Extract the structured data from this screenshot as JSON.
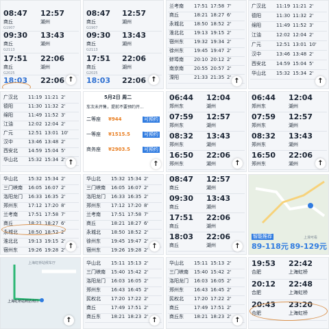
{
  "tiles": {
    "t1": {
      "rows": [
        {
          "dep": "08:47",
          "arr": "12:57",
          "from": "商丘",
          "to": "湖州",
          "train": "G1907"
        },
        {
          "dep": "09:30",
          "arr": "13:43",
          "from": "商丘",
          "to": "湖州",
          "train": "G2113"
        },
        {
          "dep": "17:51",
          "arr": "22:06",
          "from": "商丘",
          "to": "湖州",
          "train": "G2025"
        },
        {
          "dep": "18:03",
          "arr": "22:06",
          "from": "商丘",
          "to": "湖州",
          "train": ""
        }
      ]
    },
    "t2": {
      "rows": [
        {
          "dep": "08:47",
          "arr": "12:57",
          "from": "商丘",
          "to": "湖州",
          "train": "G1907"
        },
        {
          "dep": "09:30",
          "arr": "13:43",
          "from": "商丘",
          "to": "湖州",
          "train": "G2113"
        },
        {
          "dep": "17:51",
          "arr": "22:06",
          "from": "商丘",
          "to": "湖州",
          "train": "G2025"
        },
        {
          "dep": "18:03",
          "arr": "22:06",
          "from": "商丘",
          "to": "湖州",
          "train": ""
        }
      ]
    },
    "t3": {
      "rows": [
        {
          "station": "兰考南",
          "arr": "17:51",
          "dep": "17:58",
          "stop": "7'"
        },
        {
          "station": "商丘",
          "arr": "18:21",
          "dep": "18:27",
          "stop": "6'"
        },
        {
          "station": "永城北",
          "arr": "18:50",
          "dep": "18:52",
          "stop": "2'"
        },
        {
          "station": "淮北北",
          "arr": "19:13",
          "dep": "19:15",
          "stop": "2'"
        },
        {
          "station": "宿州东",
          "arr": "19:32",
          "dep": "19:34",
          "stop": "2'"
        },
        {
          "station": "徐州东",
          "arr": "19:45",
          "dep": "19:47",
          "stop": "2'"
        },
        {
          "station": "蚌埠南",
          "arr": "20:10",
          "dep": "20:12",
          "stop": "2'"
        },
        {
          "station": "南京南",
          "arr": "20:55",
          "dep": "20:57",
          "stop": "2'"
        },
        {
          "station": "溧阳",
          "arr": "21:33",
          "dep": "21:35",
          "stop": "2'"
        }
      ]
    },
    "t4": {
      "rows": [
        {
          "station": "广汉北",
          "arr": "11:19",
          "dep": "11:21",
          "stop": "2'"
        },
        {
          "station": "德阳",
          "arr": "11:30",
          "dep": "11:32",
          "stop": "2'"
        },
        {
          "station": "绵阳",
          "arr": "11:49",
          "dep": "11:52",
          "stop": "3'"
        },
        {
          "station": "江油",
          "arr": "12:02",
          "dep": "12:04",
          "stop": "2'"
        },
        {
          "station": "广元",
          "arr": "12:51",
          "dep": "13:01",
          "stop": "10'"
        },
        {
          "station": "汉中",
          "arr": "13:46",
          "dep": "13:48",
          "stop": "2'"
        },
        {
          "station": "西安北",
          "arr": "14:59",
          "dep": "15:04",
          "stop": "5'"
        },
        {
          "station": "华山北",
          "arr": "15:32",
          "dep": "15:34",
          "stop": "2'"
        }
      ]
    },
    "t5": {
      "rows": [
        {
          "station": "广汉北",
          "arr": "11:19",
          "dep": "11:21",
          "stop": "2'"
        },
        {
          "station": "德阳",
          "arr": "11:30",
          "dep": "11:32",
          "stop": "2'"
        },
        {
          "station": "绵阳",
          "arr": "11:49",
          "dep": "11:52",
          "stop": "3'"
        },
        {
          "station": "江油",
          "arr": "12:02",
          "dep": "12:04",
          "stop": "2'"
        },
        {
          "station": "广元",
          "arr": "12:51",
          "dep": "13:01",
          "stop": "10'"
        },
        {
          "station": "汉中",
          "arr": "13:46",
          "dep": "13:48",
          "stop": "2'"
        },
        {
          "station": "西安北",
          "arr": "14:59",
          "dep": "15:04",
          "stop": "5'"
        },
        {
          "station": "华山北",
          "arr": "15:32",
          "dep": "15:34",
          "stop": "2'"
        }
      ]
    },
    "t6": {
      "date": "5月2日 周二",
      "banner": "车次未开售，提前不要预约开...",
      "seats": [
        {
          "name": "二等座",
          "price": "¥944",
          "btn": "可预约"
        },
        {
          "name": "一等座",
          "price": "¥1515.5",
          "btn": "可预约"
        },
        {
          "name": "商务座",
          "price": "¥2903.5",
          "btn": "可预约"
        }
      ]
    },
    "t7": {
      "rows": [
        {
          "dep": "06:44",
          "arr": "12:04",
          "from": "郑州东",
          "to": "湖州",
          "train": ""
        },
        {
          "dep": "07:59",
          "arr": "12:57",
          "from": "郑州东",
          "to": "湖州",
          "train": ""
        },
        {
          "dep": "08:32",
          "arr": "13:43",
          "from": "郑州东",
          "to": "湖州",
          "train": ""
        },
        {
          "dep": "16:50",
          "arr": "22:06",
          "from": "郑州东",
          "to": "湖州",
          "train": ""
        }
      ]
    },
    "t8": {
      "rows": [
        {
          "dep": "06:44",
          "arr": "12:04",
          "from": "郑州东",
          "to": "湖州",
          "train": ""
        },
        {
          "dep": "07:59",
          "arr": "12:57",
          "from": "郑州东",
          "to": "湖州",
          "train": ""
        },
        {
          "dep": "08:32",
          "arr": "13:43",
          "from": "郑州东",
          "to": "湖州",
          "train": ""
        },
        {
          "dep": "16:50",
          "arr": "22:06",
          "from": "郑州东",
          "to": "湖州",
          "train": ""
        }
      ]
    },
    "t9": {
      "rows": [
        {
          "station": "华山北",
          "arr": "15:32",
          "dep": "15:34",
          "stop": "2'"
        },
        {
          "station": "三门峡南",
          "arr": "16:05",
          "dep": "16:07",
          "stop": "2'"
        },
        {
          "station": "洛阳龙门",
          "arr": "16:33",
          "dep": "16:35",
          "stop": "2'"
        },
        {
          "station": "郑州东",
          "arr": "17:12",
          "dep": "17:20",
          "stop": "8'"
        },
        {
          "station": "兰考南",
          "arr": "17:51",
          "dep": "17:58",
          "stop": "7'"
        },
        {
          "station": "商丘",
          "arr": "18:21",
          "dep": "18:27",
          "stop": "6'"
        },
        {
          "station": "永城北",
          "arr": "18:50",
          "dep": "18:52",
          "stop": "2'"
        },
        {
          "station": "淮北北",
          "arr": "19:13",
          "dep": "19:15",
          "stop": "2'"
        },
        {
          "station": "宿州东",
          "arr": "19:26",
          "dep": "19:28",
          "stop": "2'"
        }
      ]
    },
    "t10": {
      "rows": [
        {
          "station": "华山北",
          "arr": "15:32",
          "dep": "15:34",
          "stop": "2'"
        },
        {
          "station": "三门峡南",
          "arr": "16:05",
          "dep": "16:07",
          "stop": "2'"
        },
        {
          "station": "洛阳龙门",
          "arr": "16:33",
          "dep": "16:35",
          "stop": "2'"
        },
        {
          "station": "郑州东",
          "arr": "17:12",
          "dep": "17:20",
          "stop": "8'"
        },
        {
          "station": "兰考南",
          "arr": "17:51",
          "dep": "17:58",
          "stop": "7'"
        },
        {
          "station": "商丘",
          "arr": "18:21",
          "dep": "18:27",
          "stop": "6'"
        },
        {
          "station": "永城北",
          "arr": "18:50",
          "dep": "18:52",
          "stop": "2'"
        },
        {
          "station": "徐州东",
          "arr": "19:45",
          "dep": "19:47",
          "stop": "2'"
        },
        {
          "station": "宿州东",
          "arr": "19:26",
          "dep": "19:28",
          "stop": "2'"
        }
      ]
    },
    "t11": {
      "rows": [
        {
          "dep": "08:47",
          "arr": "12:57",
          "from": "商丘",
          "to": "湖州",
          "train": "G1907"
        },
        {
          "dep": "09:30",
          "arr": "13:43",
          "from": "商丘",
          "to": "湖州",
          "train": "G2113"
        },
        {
          "dep": "17:51",
          "arr": "22:06",
          "from": "商丘",
          "to": "湖州",
          "train": "G2025"
        },
        {
          "dep": "18:03",
          "arr": "22:06",
          "from": "商丘",
          "to": "湖州",
          "train": ""
        }
      ]
    },
    "t12": {
      "label": "智能推荐",
      "price": "89-118元",
      "price2": "89-129元",
      "btn": "上滑可看"
    },
    "t13": {
      "title": "上海虹桥站候车厅",
      "label": "上海虹桥站到达出口"
    },
    "t14": {
      "rows": [
        {
          "station": "华山北",
          "arr": "15:11",
          "dep": "15:13",
          "stop": "2'"
        },
        {
          "station": "三门峡南",
          "arr": "15:40",
          "dep": "15:42",
          "stop": "2'"
        },
        {
          "station": "洛阳龙门",
          "arr": "16:03",
          "dep": "16:05",
          "stop": "2'"
        },
        {
          "station": "郑州东",
          "arr": "16:43",
          "dep": "16:45",
          "stop": "2'"
        },
        {
          "station": "民权北",
          "arr": "17:20",
          "dep": "17:22",
          "stop": "2'"
        },
        {
          "station": "商丘",
          "arr": "17:49",
          "dep": "17:51",
          "stop": "2'"
        },
        {
          "station": "商丘东",
          "arr": "18:21",
          "dep": "18:23",
          "stop": "2'"
        }
      ]
    },
    "t15": {
      "rows": [
        {
          "station": "华山北",
          "arr": "15:11",
          "dep": "15:13",
          "stop": "2'"
        },
        {
          "station": "三门峡南",
          "arr": "15:40",
          "dep": "15:42",
          "stop": "2'"
        },
        {
          "station": "洛阳龙门",
          "arr": "16:03",
          "dep": "16:05",
          "stop": "2'"
        },
        {
          "station": "郑州东",
          "arr": "16:43",
          "dep": "16:45",
          "stop": "2'"
        },
        {
          "station": "民权北",
          "arr": "17:20",
          "dep": "17:22",
          "stop": "2'"
        },
        {
          "station": "商丘",
          "arr": "17:49",
          "dep": "17:51",
          "stop": "2'"
        },
        {
          "station": "商丘东",
          "arr": "18:21",
          "dep": "18:23",
          "stop": "2'"
        }
      ]
    },
    "t16": {
      "rows": [
        {
          "dep": "19:53",
          "arr": "22:42",
          "from": "合肥",
          "to": "上海虹桥",
          "train": ""
        },
        {
          "dep": "20:12",
          "arr": "22:48",
          "from": "合肥",
          "to": "上海虹桥",
          "train": ""
        },
        {
          "dep": "20:43",
          "arr": "23:20",
          "from": "合肥",
          "to": "上海虹桥",
          "train": ""
        }
      ]
    }
  },
  "icons": {
    "up": "↑"
  }
}
